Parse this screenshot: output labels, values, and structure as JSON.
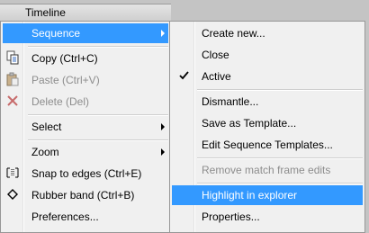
{
  "window": {
    "title": "Timeline"
  },
  "main_menu": {
    "sequence": "Sequence",
    "copy": "Copy (Ctrl+C)",
    "paste": "Paste (Ctrl+V)",
    "delete": "Delete (Del)",
    "select": "Select",
    "zoom": "Zoom",
    "snap": "Snap to edges (Ctrl+E)",
    "rubber_band": "Rubber band (Ctrl+B)",
    "preferences": "Preferences..."
  },
  "sequence_submenu": {
    "create_new": "Create new...",
    "close": "Close",
    "active": "Active",
    "dismantle": "Dismantle...",
    "save_as_template": "Save as Template...",
    "edit_templates": "Edit Sequence Templates...",
    "remove_match": "Remove match frame edits",
    "highlight": "Highlight in explorer",
    "properties": "Properties..."
  },
  "colors": {
    "highlight": "#3399ff",
    "menu_bg": "#f0f0f0",
    "disabled_text": "#8d8d8d"
  }
}
